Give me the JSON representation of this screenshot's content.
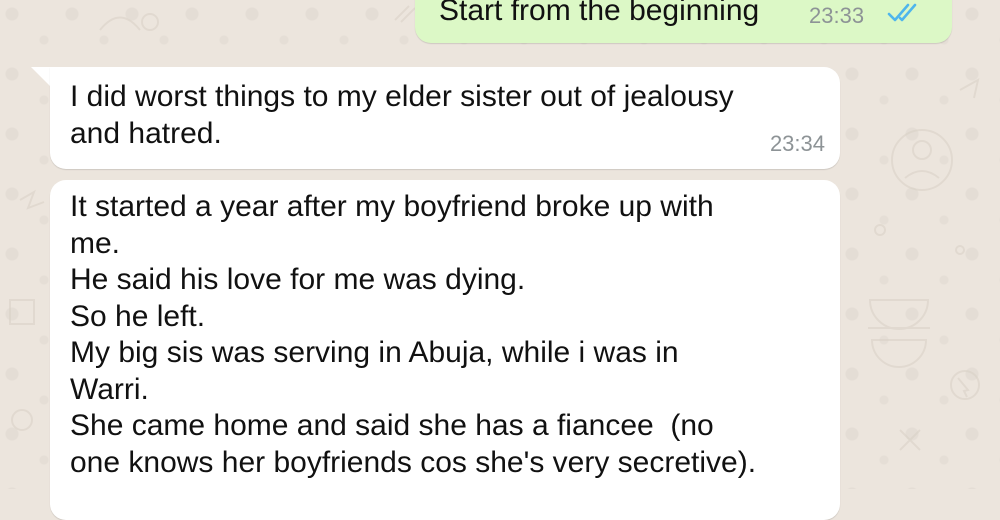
{
  "chat": {
    "messages": [
      {
        "direction": "outgoing",
        "text": "Start from the beginning",
        "time": "23:33",
        "status_icon": "double-check-read-icon"
      },
      {
        "direction": "incoming",
        "text": "I did worst things to my elder sister out of jealousy\nand hatred.",
        "time": "23:34"
      },
      {
        "direction": "incoming",
        "text": "It started a year after my boyfriend broke up with\nme.\nHe said his love for me was dying.\nSo he left.\nMy big sis was serving in Abuja, while i was in\nWarri.\nShe came home and said she has a fiancee  (no\none knows her boyfriends cos she's very secretive).",
        "time": ""
      }
    ]
  },
  "colors": {
    "wallpaper": "#ece5dd",
    "outgoing_bubble": "#dcf8c6",
    "incoming_bubble": "#ffffff",
    "read_tick": "#4fb6ec",
    "timestamp": "#8d9396"
  }
}
